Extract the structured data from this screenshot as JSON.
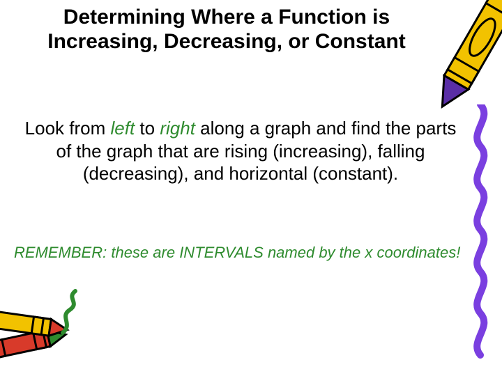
{
  "title": "Determining Where a Function is Increasing, Decreasing, or Constant",
  "body": {
    "seg1": "Look from ",
    "left": "left",
    "seg2": " to ",
    "right": "right",
    "seg3": " along a graph and find the parts of the graph that are rising (increasing), falling (decreasing), and horizontal (constant)."
  },
  "remember": {
    "seg1": "REMEMBER:  these are INTERVALS named by the ",
    "x": "x",
    "seg2": " coordinates!"
  }
}
